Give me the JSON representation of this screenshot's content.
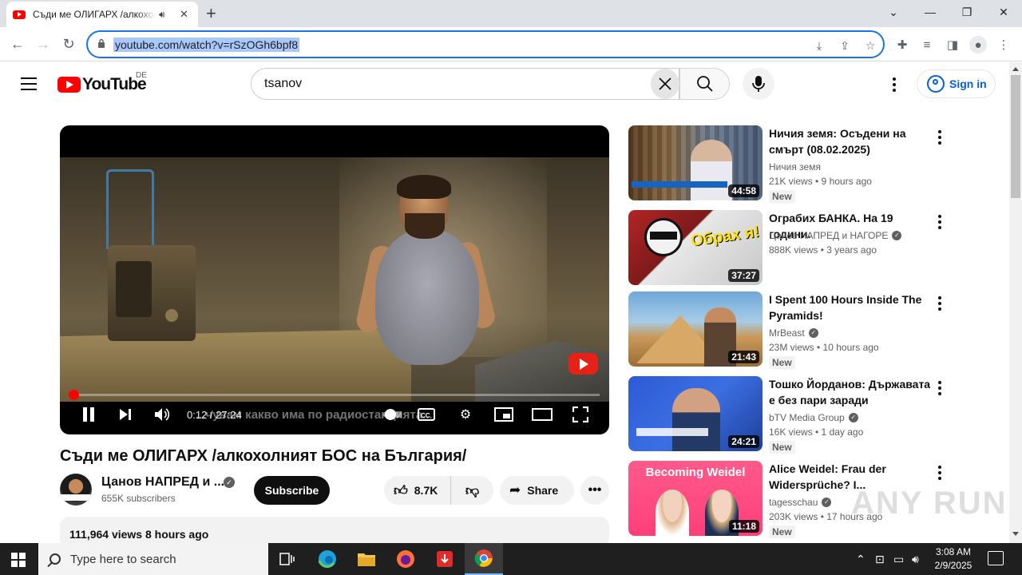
{
  "browser": {
    "tab_title": "Съди ме ОЛИГАРХ /алкохолният БОС на България/",
    "address": "youtube.com/watch?v=rSzOGh6bpf8"
  },
  "youtube": {
    "logo_text": "YouTube",
    "region": "DE",
    "search_query": "tsanov",
    "sign_in_label": "Sign in"
  },
  "player": {
    "time_text": "0:12 / 27:24",
    "subtitle_text": "...чувам какво има по радиостанцията...",
    "progress_percent": 0.7
  },
  "video": {
    "title": "Съди ме ОЛИГАРХ /алкохолният БОС на България/",
    "channel_name": "Цанов НАПРЕД и ...",
    "subscribers": "655K subscribers",
    "subscribe_label": "Subscribe",
    "likes": "8.7K",
    "share_label": "Share",
    "description_meta": "111,964 views  8 hours ago"
  },
  "recommendations": [
    {
      "title": "Ничия земя: Осъдени на смърт (08.02.2025)",
      "channel": "Ничия земя",
      "verified": false,
      "stats": "21K views  •  9 hours ago",
      "badge": "New",
      "duration": "44:58"
    },
    {
      "title": "Ограбих БАНКА. На 19 години.",
      "channel": "Цанов НАПРЕД и НАГОРЕ",
      "verified": true,
      "stats": "888K views  •  3 years ago",
      "badge": "",
      "duration": "37:27",
      "thumb_text": "Обрах я!"
    },
    {
      "title": "I Spent 100 Hours Inside The Pyramids!",
      "channel": "MrBeast",
      "verified": true,
      "stats": "23M views  •  10 hours ago",
      "badge": "New",
      "duration": "21:43"
    },
    {
      "title": "Тошко Йорданов: Държавата е без пари заради бюджетит...",
      "channel": "bTV Media Group",
      "verified": true,
      "stats": "16K views  •  1 day ago",
      "badge": "New",
      "duration": "24:21"
    },
    {
      "title": "Alice Weidel: Frau der Widersprüche? I...",
      "channel": "tagesschau",
      "verified": true,
      "stats": "203K views  •  17 hours ago",
      "badge": "New",
      "duration": "11:18",
      "thumb_text": "Becoming Weidel"
    }
  ],
  "taskbar": {
    "search_placeholder": "Type here to search",
    "time": "3:08 AM",
    "date": "2/9/2025"
  },
  "watermark": "ANY RUN"
}
